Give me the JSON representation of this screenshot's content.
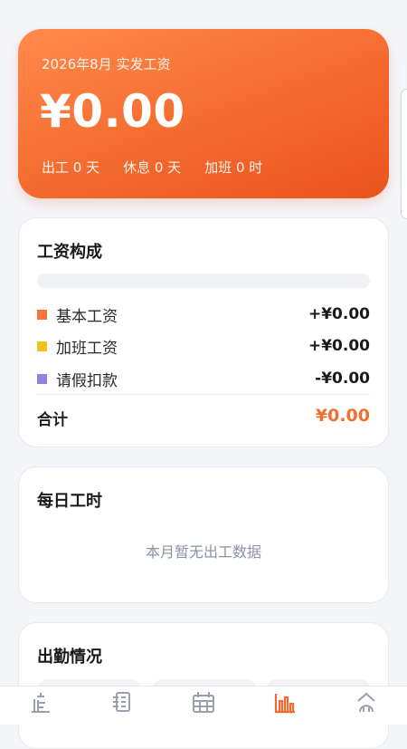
{
  "summary": {
    "period": "2026年8月 实发工资",
    "amount": "¥0.00",
    "work_days": "出工 0 天",
    "rest_days": "休息 0 天",
    "overtime": "加班 0 时"
  },
  "breakdown": {
    "title": "工资构成",
    "items": [
      {
        "label": "基本工资",
        "value": "+¥0.00",
        "color": "#f4763a"
      },
      {
        "label": "加班工资",
        "value": "+¥0.00",
        "color": "#f6be1e"
      },
      {
        "label": "请假扣款",
        "value": "-¥0.00",
        "color": "#9a7fdc"
      }
    ],
    "total_label": "合计",
    "total_value": "¥0.00"
  },
  "daily_hours": {
    "title": "每日工时",
    "empty_text": "本月暂无出工数据"
  },
  "attendance": {
    "title": "出勤情况"
  },
  "colors": {
    "accent": "#f46a2e",
    "inactive_tab": "#9aa0ab"
  },
  "tabbar": {
    "tabs": [
      {
        "icon": "home-icon",
        "label": "",
        "active": false
      },
      {
        "icon": "ledger-icon",
        "label": "",
        "active": false
      },
      {
        "icon": "calendar-icon",
        "label": "",
        "active": false
      },
      {
        "icon": "bar-chart-icon",
        "label": "",
        "active": true
      },
      {
        "icon": "profile-icon",
        "label": "",
        "active": false
      }
    ]
  }
}
